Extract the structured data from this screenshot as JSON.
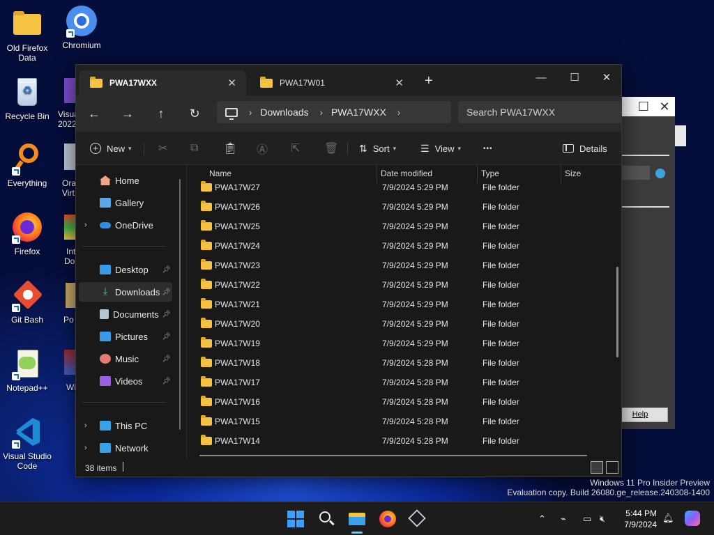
{
  "desktop": {
    "icons": [
      {
        "label": "Old Firefox Data"
      },
      {
        "label": "Chromium"
      },
      {
        "label": "Recycle Bin"
      },
      {
        "label": "Everything"
      },
      {
        "label": "Firefox"
      },
      {
        "label": "Git Bash"
      },
      {
        "label": "Notepad++"
      },
      {
        "label": "Visual Studio Code"
      }
    ],
    "partial_labels": [
      "Visua",
      "2022",
      "Ora",
      "Virt",
      "Int",
      "Do",
      "Po",
      "Wi"
    ]
  },
  "background_dialog": {
    "help_label": "Help",
    "close_glyph": "✕",
    "max_glyph": "☐"
  },
  "explorer": {
    "tabs": [
      {
        "label": "PWA17WXX",
        "active": true
      },
      {
        "label": "PWA17W01",
        "active": false
      }
    ],
    "new_tab_glyph": "+",
    "window_controls": {
      "minimize": "—",
      "maximize": "☐",
      "close": "✕"
    },
    "nav": {
      "back": "←",
      "forward": "→",
      "up": "↑",
      "refresh": "↻"
    },
    "breadcrumb": [
      "Downloads",
      "PWA17WXX"
    ],
    "search": {
      "placeholder": "Search PWA17WXX"
    },
    "commands": {
      "new": "New",
      "sort": "Sort",
      "view": "View",
      "more": "•••",
      "details": "Details"
    },
    "sidebar": {
      "top": [
        {
          "label": "Home",
          "icon": "home-icon"
        },
        {
          "label": "Gallery",
          "icon": "gallery-icon"
        },
        {
          "label": "OneDrive",
          "icon": "onedrive-icon"
        }
      ],
      "pinned": [
        {
          "label": "Desktop",
          "icon": "desktop-icon"
        },
        {
          "label": "Downloads",
          "icon": "download-icon"
        },
        {
          "label": "Documents",
          "icon": "documents-icon"
        },
        {
          "label": "Pictures",
          "icon": "pictures-icon"
        },
        {
          "label": "Music",
          "icon": "music-icon"
        },
        {
          "label": "Videos",
          "icon": "videos-icon"
        }
      ],
      "bottom": [
        {
          "label": "This PC",
          "icon": "this-pc-icon"
        },
        {
          "label": "Network",
          "icon": "network-icon"
        }
      ]
    },
    "columns": {
      "name": "Name",
      "date": "Date modified",
      "type": "Type",
      "size": "Size"
    },
    "rows": [
      {
        "name": "PWA17W27",
        "date": "7/9/2024 5:29 PM",
        "type": "File folder"
      },
      {
        "name": "PWA17W26",
        "date": "7/9/2024 5:29 PM",
        "type": "File folder"
      },
      {
        "name": "PWA17W25",
        "date": "7/9/2024 5:29 PM",
        "type": "File folder"
      },
      {
        "name": "PWA17W24",
        "date": "7/9/2024 5:29 PM",
        "type": "File folder"
      },
      {
        "name": "PWA17W23",
        "date": "7/9/2024 5:29 PM",
        "type": "File folder"
      },
      {
        "name": "PWA17W22",
        "date": "7/9/2024 5:29 PM",
        "type": "File folder"
      },
      {
        "name": "PWA17W21",
        "date": "7/9/2024 5:29 PM",
        "type": "File folder"
      },
      {
        "name": "PWA17W20",
        "date": "7/9/2024 5:29 PM",
        "type": "File folder"
      },
      {
        "name": "PWA17W19",
        "date": "7/9/2024 5:29 PM",
        "type": "File folder"
      },
      {
        "name": "PWA17W18",
        "date": "7/9/2024 5:28 PM",
        "type": "File folder"
      },
      {
        "name": "PWA17W17",
        "date": "7/9/2024 5:28 PM",
        "type": "File folder"
      },
      {
        "name": "PWA17W16",
        "date": "7/9/2024 5:28 PM",
        "type": "File folder"
      },
      {
        "name": "PWA17W15",
        "date": "7/9/2024 5:28 PM",
        "type": "File folder"
      },
      {
        "name": "PWA17W14",
        "date": "7/9/2024 5:28 PM",
        "type": "File folder"
      }
    ],
    "status": {
      "item_count": "38 items"
    }
  },
  "watermark": {
    "line1": "Windows 11 Pro Insider Preview",
    "line2": "Evaluation copy. Build 26080.ge_release.240308-1400"
  },
  "taskbar": {
    "clock_time": "5:44 PM",
    "clock_date": "7/9/2024",
    "apps": [
      "start-icon",
      "search-icon",
      "file-explorer-icon",
      "firefox-icon",
      "virtualbox-icon"
    ]
  },
  "colors": {
    "folder": "#f5c242",
    "accent": "#60cdff",
    "window_bg": "#191919"
  }
}
